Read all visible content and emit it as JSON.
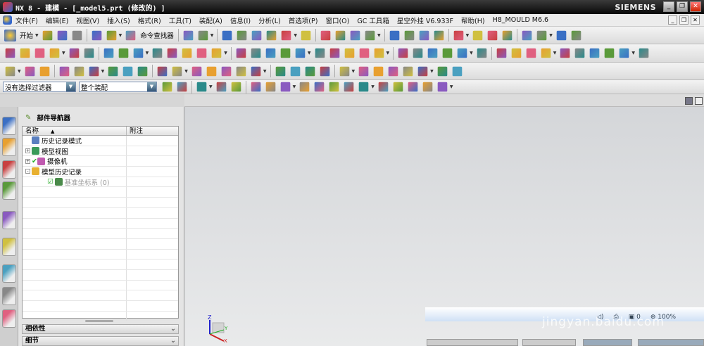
{
  "title": {
    "text": "NX 8 - 建模 - [_model5.prt  (修改的) ]",
    "brand": "SIEMENS"
  },
  "menu": [
    "文件(F)",
    "编辑(E)",
    "视图(V)",
    "插入(S)",
    "格式(R)",
    "工具(T)",
    "装配(A)",
    "信息(I)",
    "分析(L)",
    "首选项(P)",
    "窗口(O)",
    "GC 工具箱",
    "星空外挂 V6.933F",
    "帮助(H)",
    "H8_MOULD M6.6"
  ],
  "toolbar": {
    "start_label": "开始",
    "command_finder_label": "命令查找器"
  },
  "filters": {
    "selection_filter": "没有选择过滤器",
    "scope": "整个装配"
  },
  "navigator": {
    "title": "部件导航器",
    "columns": [
      "名称",
      "附注"
    ],
    "items": [
      {
        "label": "历史记录模式",
        "expander": "",
        "icon": "clock-icon",
        "color": "#5a7fbf",
        "dim": false,
        "indent": 0
      },
      {
        "label": "模型视图",
        "expander": "+",
        "icon": "model-views-icon",
        "color": "#3a9a5a",
        "dim": false,
        "indent": 0
      },
      {
        "label": "摄像机",
        "expander": "+",
        "icon": "camera-icon",
        "color": "#c05ab0",
        "dim": false,
        "indent": 0,
        "check": true
      },
      {
        "label": "模型历史记录",
        "expander": "-",
        "icon": "folder-icon",
        "color": "#e8b030",
        "dim": false,
        "indent": 0
      },
      {
        "label": "基准坐标系 (0)",
        "expander": "",
        "icon": "datum-csys-icon",
        "color": "#4a8a4a",
        "dim": true,
        "indent": 1,
        "checkbox": true
      }
    ],
    "panels": [
      "相依性",
      "细节"
    ]
  },
  "status": {
    "count": "0",
    "zoom": "100%"
  },
  "watermark": "jingyan.baidu.com",
  "axes": {
    "z": "Z",
    "y": "Y",
    "x": "X"
  }
}
